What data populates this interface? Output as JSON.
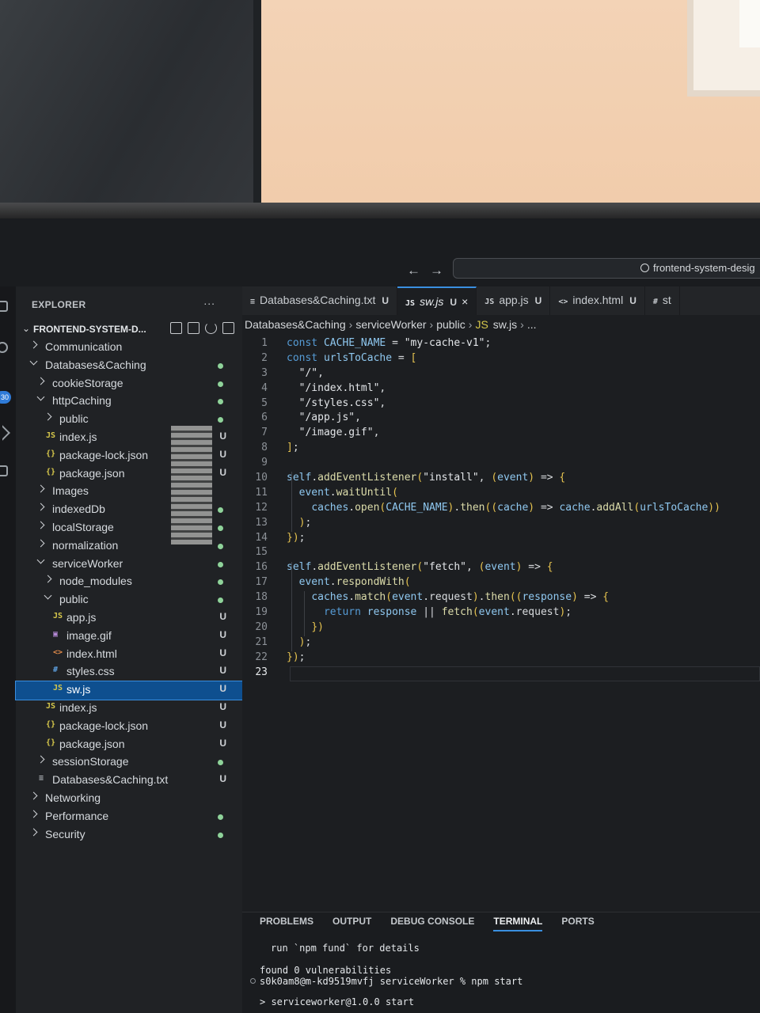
{
  "window": {
    "search_text": "frontend-system-desig"
  },
  "activity_bar": {
    "badge": "30"
  },
  "explorer": {
    "title": "EXPLORER",
    "more": "...",
    "root_label": "FRONTEND-SYSTEM-D...",
    "tree": [
      {
        "label": "Communication",
        "kind": "folder",
        "expanded": false,
        "depth": 0,
        "status": ""
      },
      {
        "label": "Databases&Caching",
        "kind": "folder",
        "expanded": true,
        "depth": 0,
        "status": "dot"
      },
      {
        "label": "cookieStorage",
        "kind": "folder",
        "expanded": false,
        "depth": 1,
        "status": "dot"
      },
      {
        "label": "httpCaching",
        "kind": "folder",
        "expanded": true,
        "depth": 1,
        "status": "dot"
      },
      {
        "label": "public",
        "kind": "folder",
        "expanded": false,
        "depth": 2,
        "status": "dot"
      },
      {
        "label": "index.js",
        "kind": "js",
        "depth": 2,
        "status": "U"
      },
      {
        "label": "package-lock.json",
        "kind": "json",
        "depth": 2,
        "status": "U"
      },
      {
        "label": "package.json",
        "kind": "json",
        "depth": 2,
        "status": "U"
      },
      {
        "label": "Images",
        "kind": "folder",
        "expanded": false,
        "depth": 1,
        "status": ""
      },
      {
        "label": "indexedDb",
        "kind": "folder",
        "expanded": false,
        "depth": 1,
        "status": "dot"
      },
      {
        "label": "localStorage",
        "kind": "folder",
        "expanded": false,
        "depth": 1,
        "status": "dot"
      },
      {
        "label": "normalization",
        "kind": "folder",
        "expanded": false,
        "depth": 1,
        "status": "dot"
      },
      {
        "label": "serviceWorker",
        "kind": "folder",
        "expanded": true,
        "depth": 1,
        "status": "dot"
      },
      {
        "label": "node_modules",
        "kind": "folder",
        "expanded": false,
        "depth": 2,
        "status": "dot"
      },
      {
        "label": "public",
        "kind": "folder",
        "expanded": true,
        "depth": 2,
        "status": "dot"
      },
      {
        "label": "app.js",
        "kind": "js",
        "depth": 3,
        "status": "U"
      },
      {
        "label": "image.gif",
        "kind": "gif",
        "depth": 3,
        "status": "U"
      },
      {
        "label": "index.html",
        "kind": "html",
        "depth": 3,
        "status": "U"
      },
      {
        "label": "styles.css",
        "kind": "css",
        "depth": 3,
        "status": "U"
      },
      {
        "label": "sw.js",
        "kind": "js",
        "depth": 3,
        "status": "U",
        "selected": true
      },
      {
        "label": "index.js",
        "kind": "js",
        "depth": 2,
        "status": "U"
      },
      {
        "label": "package-lock.json",
        "kind": "json",
        "depth": 2,
        "status": "U"
      },
      {
        "label": "package.json",
        "kind": "json",
        "depth": 2,
        "status": "U"
      },
      {
        "label": "sessionStorage",
        "kind": "folder",
        "expanded": false,
        "depth": 1,
        "status": "dot"
      },
      {
        "label": "Databases&Caching.txt",
        "kind": "txt",
        "depth": 1,
        "status": "U"
      },
      {
        "label": "Networking",
        "kind": "folder",
        "expanded": false,
        "depth": 0,
        "status": ""
      },
      {
        "label": "Performance",
        "kind": "folder",
        "expanded": false,
        "depth": 0,
        "status": "dot"
      },
      {
        "label": "Security",
        "kind": "folder",
        "expanded": false,
        "depth": 0,
        "status": "dot"
      }
    ]
  },
  "file_icons": {
    "js": "JS",
    "json": "{}",
    "html": "<>",
    "css": "#",
    "gif": "▣",
    "txt": "≡"
  },
  "tabs": [
    {
      "icon": "≡",
      "label": "Databases&Caching.txt",
      "status": "U",
      "active": false
    },
    {
      "icon": "JS",
      "label": "sw.js",
      "status": "U",
      "active": true,
      "close": "×"
    },
    {
      "icon": "JS",
      "label": "app.js",
      "status": "U",
      "active": false
    },
    {
      "icon": "<>",
      "label": "index.html",
      "status": "U",
      "active": false
    },
    {
      "icon": "#",
      "label": "st",
      "status": "",
      "active": false
    }
  ],
  "breadcrumb": [
    "Databases&Caching",
    "serviceWorker",
    "public",
    "sw.js",
    "..."
  ],
  "breadcrumb_file_icon": "JS",
  "code_lines": [
    "const CACHE_NAME = \"my-cache-v1\";",
    "const urlsToCache = [",
    "  \"/\",",
    "  \"/index.html\",",
    "  \"/styles.css\",",
    "  \"/app.js\",",
    "  \"/image.gif\",",
    "];",
    "",
    "self.addEventListener(\"install\", (event) => {",
    "  event.waitUntil(",
    "    caches.open(CACHE_NAME).then((cache) => cache.addAll(urlsToCache))",
    "  );",
    "});",
    "",
    "self.addEventListener(\"fetch\", (event) => {",
    "  event.respondWith(",
    "    caches.match(event.request).then((response) => {",
    "      return response || fetch(event.request);",
    "    })",
    "  );",
    "});",
    ""
  ],
  "current_line": 23,
  "panel": {
    "tabs": [
      "PROBLEMS",
      "OUTPUT",
      "DEBUG CONSOLE",
      "TERMINAL",
      "PORTS"
    ],
    "active_tab": "TERMINAL",
    "terminal_lines": [
      "run `npm fund` for details",
      "found 0 vulnerabilities",
      "s0k0am8@m-kd9519mvfj serviceWorker % npm start",
      "> serviceworker@1.0.0 start"
    ]
  },
  "colors": {
    "accent": "#3a8fe0",
    "selection": "#0e4f8f",
    "untracked_dot": "#8fd39a",
    "keyword": "#569cd6",
    "variable": "#8fc8f0",
    "function": "#dcdcaa"
  }
}
